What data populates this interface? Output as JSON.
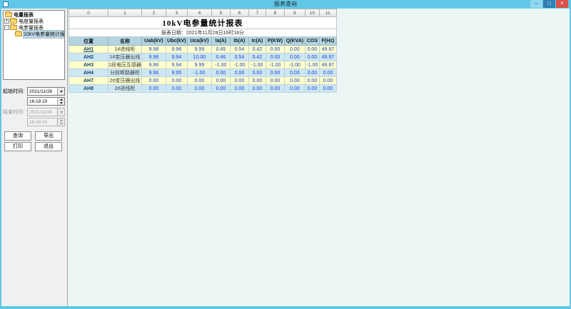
{
  "window": {
    "title": "报表查询",
    "controls": {
      "minimize": "–",
      "maximize": "□",
      "close": "×"
    }
  },
  "sidebar": {
    "tree": {
      "root_label": "电量报表",
      "items": [
        {
          "label": "电度量报表",
          "expander": "+"
        },
        {
          "label": "电参量报表",
          "expander": "-"
        },
        {
          "label": "10kV电参量统计报表",
          "selected": true
        }
      ]
    },
    "start_time_label": "起始时间:",
    "start_date": "2021/11/28",
    "start_time": "16:18:10",
    "end_time_label": "结束时间:",
    "end_date": "2021/11/28",
    "end_time": "16:18:10",
    "buttons": {
      "query": "查询",
      "export": "导出",
      "print": "打印",
      "exit": "退出"
    }
  },
  "report": {
    "column_numbers": [
      "0",
      "1",
      "2",
      "3",
      "4",
      "5",
      "6",
      "7",
      "8",
      "9",
      "10",
      "11"
    ],
    "title": "10kV电参量统计报表",
    "date_line": "报表日期：2021年11月28日16时18分",
    "headers": [
      "位置",
      "名称",
      "Uab(kV)",
      "Ubc(kV)",
      "Uca(kV)",
      "Ia(A)",
      "Ib(A)",
      "Ic(A)",
      "P(KW)",
      "Q(KVA)",
      "COS",
      "F(Hz)"
    ],
    "rows": [
      [
        "AH1",
        "1#进线柜",
        "9.98",
        "9.96",
        "9.99",
        "0.45",
        "0.54",
        "0.42",
        "0.00",
        "0.00",
        "0.00",
        "49.97"
      ],
      [
        "AH2",
        "1#变压器出线",
        "9.96",
        "9.94",
        "10.00",
        "0.46",
        "0.54",
        "0.42",
        "0.00",
        "0.00",
        "0.00",
        "49.97"
      ],
      [
        "AH3",
        "1段电压互感器",
        "9.96",
        "9.94",
        "9.99",
        "-1.00",
        "-1.00",
        "-1.00",
        "-1.00",
        "-1.00",
        "-1.00",
        "49.97"
      ],
      [
        "AH4",
        "分段断路器柜",
        "9.96",
        "9.95",
        "-1.00",
        "0.00",
        "0.00",
        "0.00",
        "0.00",
        "0.00",
        "0.00",
        "0.00"
      ],
      [
        "AH7",
        "2#变压器出线",
        "0.00",
        "0.00",
        "0.00",
        "0.00",
        "0.00",
        "0.00",
        "0.00",
        "0.00",
        "0.00",
        "0.00"
      ],
      [
        "AH8",
        "2#进线柜",
        "0.00",
        "0.00",
        "0.00",
        "0.00",
        "0.00",
        "0.00",
        "0.00",
        "0.00",
        "0.00",
        "0.00"
      ]
    ]
  },
  "colors": {
    "titlebar": "#61c7e6",
    "close_button": "#d9534a",
    "maximize_button": "#2e7fb5",
    "sheet_background": "#ecf6f4",
    "header_row": "#b3d4e0",
    "row_yellow": "#ffffcc",
    "row_blue": "#cbe7f3",
    "numeric_text": "#2244cc"
  }
}
